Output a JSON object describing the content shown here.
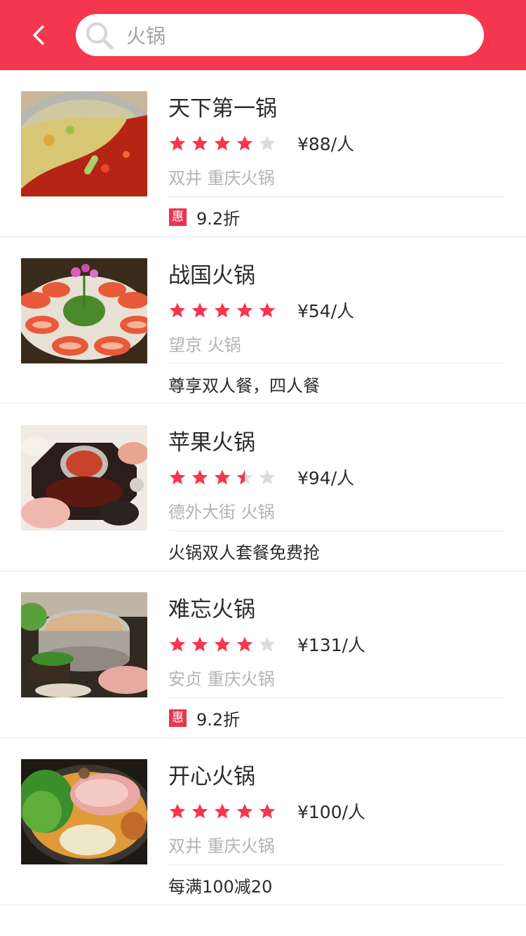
{
  "header": {
    "back_icon": "chevron-left-icon",
    "search_icon": "search-icon",
    "search_value": "火锅",
    "accent_color": "#f5364f"
  },
  "restaurants": [
    {
      "name": "天下第一锅",
      "rating": 4,
      "price": "¥88/人",
      "location": "双井 重庆火锅",
      "promo": {
        "badge": "惠",
        "text": "9.2折"
      },
      "image": "hotpot-yinyang"
    },
    {
      "name": "战国火锅",
      "rating": 5,
      "price": "¥54/人",
      "location": "望京 火锅",
      "promo": {
        "badge": "",
        "text": "尊享双人餐，四人餐"
      },
      "image": "meat-rolls-flower"
    },
    {
      "name": "苹果火锅",
      "rating": 3.5,
      "price": "¥94/人",
      "location": "德外大街 火锅",
      "promo": {
        "badge": "",
        "text": "火锅双人套餐免费抢"
      },
      "image": "hotpot-table-spread"
    },
    {
      "name": "难忘火锅",
      "rating": 4,
      "price": "¥131/人",
      "location": "安贞 重庆火锅",
      "promo": {
        "badge": "惠",
        "text": "9.2折"
      },
      "image": "hotpot-pot-sides"
    },
    {
      "name": "开心火锅",
      "rating": 5,
      "price": "¥100/人",
      "location": "双井 重庆火锅",
      "promo": {
        "badge": "",
        "text": "每满100减20"
      },
      "image": "hotpot-greens-meat"
    }
  ],
  "colors": {
    "star_filled": "#f5364f",
    "star_empty": "#dcdcdc",
    "badge": "#e8354d"
  }
}
